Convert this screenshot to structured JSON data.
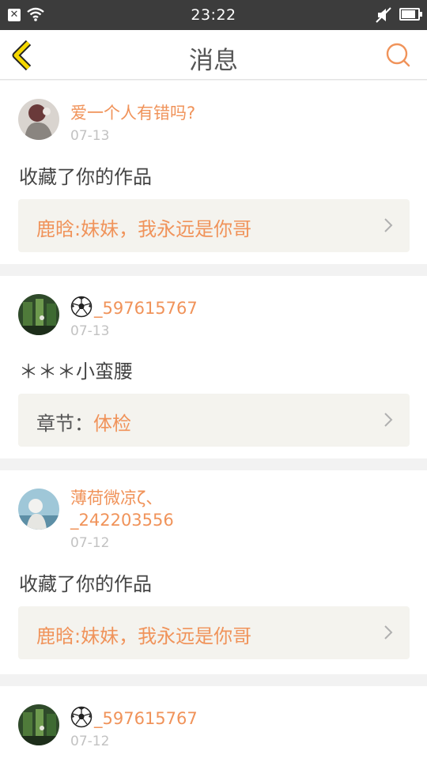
{
  "status_bar": {
    "time": "23:22"
  },
  "header": {
    "title": "消息"
  },
  "messages": [
    {
      "user": "爱一个人有错吗?",
      "date": "07-13",
      "action": "收藏了你的作品",
      "target": "鹿晗:妹妹，我永远是你哥"
    },
    {
      "user": "_597615767",
      "date": "07-13",
      "action": "＊＊＊小蛮腰",
      "target_label": "章节：",
      "target": "体检"
    },
    {
      "user_line1": "薄荷微凉ζ、",
      "user_line2": "_242203556",
      "date": "07-12",
      "action": "收藏了你的作品",
      "target": "鹿晗:妹妹，我永远是你哥"
    },
    {
      "user": "_597615767",
      "date": "07-12"
    }
  ]
}
